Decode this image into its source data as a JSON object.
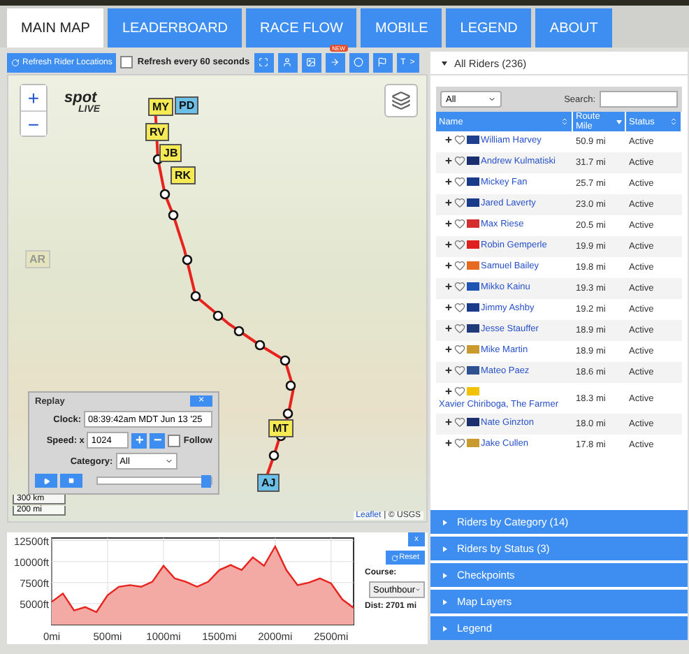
{
  "tabs": [
    {
      "label": "MAIN MAP",
      "selected": true
    },
    {
      "label": "LEADERBOARD",
      "selected": false
    },
    {
      "label": "RACE FLOW",
      "selected": false
    },
    {
      "label": "MOBILE",
      "selected": false
    },
    {
      "label": "LEGEND",
      "selected": false
    },
    {
      "label": "ABOUT",
      "selected": false
    }
  ],
  "toolbar": {
    "refresh_button": "Refresh Rider Locations",
    "auto_refresh": {
      "label": "Refresh every 60 seconds",
      "checked": false
    },
    "new_badge": "NEW",
    "text_button": "T",
    "more_button": ">"
  },
  "map": {
    "logo": {
      "top": "spot",
      "bottom": "LIVE"
    },
    "zoom_in": "+",
    "zoom_out": "−",
    "markers": [
      {
        "label": "MY",
        "kind": "active"
      },
      {
        "label": "PD",
        "kind": "stale"
      },
      {
        "label": "RV",
        "kind": "active"
      },
      {
        "label": "JB",
        "kind": "active"
      },
      {
        "label": "RK",
        "kind": "active"
      },
      {
        "label": "MT",
        "kind": "active"
      },
      {
        "label": "AJ",
        "kind": "stale"
      },
      {
        "label": "AR",
        "kind": "faded"
      }
    ],
    "scale": [
      "300 km",
      "200 mi"
    ],
    "attribution_link": "Leaflet",
    "attribution": "| © USGS"
  },
  "replay": {
    "title": "Replay",
    "close": "×",
    "clock_label": "Clock:",
    "clock": "08:39:42am MDT Jun 13 '25",
    "speed_label": "Speed: x",
    "speed": "1024",
    "plus": "+",
    "minus": "−",
    "follow": {
      "label": "Follow",
      "checked": false
    },
    "category_label": "Category:",
    "category": "All",
    "level": 1
  },
  "elevation": {
    "close": "x",
    "reset": "Reset",
    "course_label": "Course:",
    "course": "Southbour",
    "distance": "Dist: 2701 mi",
    "chart_data": {
      "type": "area",
      "x": [
        0,
        100,
        200,
        300,
        400,
        500,
        600,
        700,
        800,
        900,
        1000,
        1100,
        1200,
        1300,
        1400,
        1500,
        1600,
        1700,
        1800,
        1900,
        2000,
        2100,
        2200,
        2300,
        2400,
        2500,
        2600,
        2701
      ],
      "grid": true,
      "series": [
        {
          "color": "#e8231e",
          "values": [
            5200,
            6200,
            4200,
            4600,
            4000,
            6000,
            7000,
            7200,
            7000,
            7600,
            9500,
            8000,
            7600,
            7000,
            7600,
            9000,
            9600,
            9000,
            10500,
            9500,
            11800,
            9000,
            7200,
            7500,
            8000,
            7400,
            5500,
            4500
          ]
        }
      ],
      "xlim": [
        0,
        2701
      ],
      "ylim": [
        2500,
        12800
      ],
      "xticks": [
        {
          "value": 0,
          "label": "0mi"
        },
        {
          "value": 500,
          "label": "500mi"
        },
        {
          "value": 1000,
          "label": "1000mi"
        },
        {
          "value": 1500,
          "label": "1500mi"
        },
        {
          "value": 2000,
          "label": "2000mi"
        },
        {
          "value": 2500,
          "label": "2500mi"
        }
      ],
      "yticks": [
        {
          "value": 5000,
          "label": "5000ft"
        },
        {
          "value": 7500,
          "label": "7500ft"
        },
        {
          "value": 10000,
          "label": "10000ft"
        },
        {
          "value": 12500,
          "label": "12500ft"
        }
      ]
    }
  },
  "riders_panel": {
    "title": "All Riders (236)",
    "filter": "All",
    "search_label": "Search:",
    "columns": [
      "Name",
      "Route Mile",
      "Status"
    ],
    "rows": [
      {
        "name": "William Harvey",
        "mile": "50.9 mi",
        "status": "Active",
        "color": "#1f3f8f"
      },
      {
        "name": "Andrew Kulmatiski",
        "mile": "31.7 mi",
        "status": "Active",
        "color": "#1a2f6f"
      },
      {
        "name": "Mickey Fan",
        "mile": "25.7 mi",
        "status": "Active",
        "color": "#1a3a8a"
      },
      {
        "name": "Jared Laverty",
        "mile": "23.0 mi",
        "status": "Active",
        "color": "#1a3a8a"
      },
      {
        "name": "Max Riese",
        "mile": "20.5 mi",
        "status": "Active",
        "color": "#d32f2f"
      },
      {
        "name": "Robin Gemperle",
        "mile": "19.9 mi",
        "status": "Active",
        "color": "#e0201e"
      },
      {
        "name": "Samuel Bailey",
        "mile": "19.8 mi",
        "status": "Active",
        "color": "#e66a1f"
      },
      {
        "name": "Mikko Kainu",
        "mile": "19.3 mi",
        "status": "Active",
        "color": "#1e55b3"
      },
      {
        "name": "Jimmy Ashby",
        "mile": "19.2 mi",
        "status": "Active",
        "color": "#1a3a8a"
      },
      {
        "name": "Jesse Stauffer",
        "mile": "18.9 mi",
        "status": "Active",
        "color": "#203a7a"
      },
      {
        "name": "Mike Martin",
        "mile": "18.9 mi",
        "status": "Active",
        "color": "#c99a2e"
      },
      {
        "name": "Mateo Paez",
        "mile": "18.6 mi",
        "status": "Active",
        "color": "#30518f"
      },
      {
        "name": "Xavier Chiriboga, The Farmer",
        "mile": "18.3 mi",
        "status": "Active",
        "color": "#f2c200"
      },
      {
        "name": "Nate Ginzton",
        "mile": "18.0 mi",
        "status": "Active",
        "color": "#1c2f6e"
      },
      {
        "name": "Jake Cullen",
        "mile": "17.8 mi",
        "status": "Active",
        "color": "#c99a2e"
      }
    ]
  },
  "sections": [
    "Riders by Category (14)",
    "Riders by Status (3)",
    "Checkpoints",
    "Map Layers",
    "Legend"
  ]
}
